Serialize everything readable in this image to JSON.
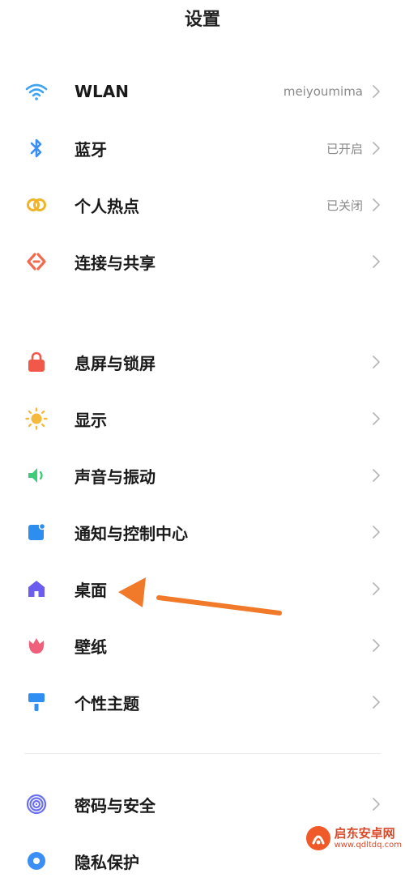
{
  "header": {
    "title": "设置"
  },
  "settings": {
    "wlan": {
      "label": "WLAN",
      "value": "meiyoumima"
    },
    "bluetooth": {
      "label": "蓝牙",
      "value": "已开启"
    },
    "hotspot": {
      "label": "个人热点",
      "value": "已关闭"
    },
    "connection": {
      "label": "连接与共享"
    },
    "lockscreen": {
      "label": "息屏与锁屏"
    },
    "display": {
      "label": "显示"
    },
    "sound": {
      "label": "声音与振动"
    },
    "notification": {
      "label": "通知与控制中心"
    },
    "desktop": {
      "label": "桌面"
    },
    "wallpaper": {
      "label": "壁纸"
    },
    "theme": {
      "label": "个性主题"
    },
    "security": {
      "label": "密码与安全"
    },
    "privacy": {
      "label": "隐私保护"
    }
  },
  "colors": {
    "wlan": "#3fa4f0",
    "bluetooth": "#3a8ef6",
    "hotspot": "#f0b429",
    "connection": "#f26b4f",
    "lockscreen": "#f2584a",
    "display": "#f5b93b",
    "sound": "#3ecb7a",
    "notification": "#2c8ff0",
    "desktop": "#6b5cf0",
    "wallpaper": "#f0607a",
    "theme": "#2f8ef2",
    "security": "#6a6ff0",
    "arrow": "#f07a2a"
  },
  "watermark": {
    "title": "启东安卓网",
    "url": "www.qdltdq.com"
  }
}
